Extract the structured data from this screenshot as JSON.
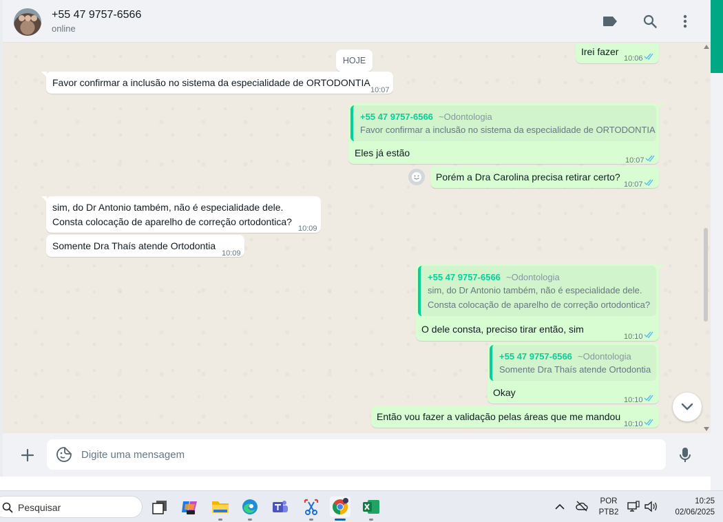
{
  "header": {
    "contact_name": "+55 47 9757-6566",
    "status": "online",
    "icons": [
      "label-icon",
      "search-icon",
      "menu-icon"
    ]
  },
  "chat": {
    "date_chip": "HOJE",
    "messages": [
      {
        "dir": "out",
        "text": "Irei fazer",
        "time": "10:06",
        "ticks": "read"
      },
      {
        "dir": "in",
        "text": "Favor confirmar a inclusão no sistema da especialidade de ORTODONTIA",
        "time": "10:07"
      },
      {
        "dir": "out",
        "quote": {
          "sender": "+55 47 9757-6566",
          "org": "~Odontologia",
          "lines": [
            "Favor confirmar a inclusão no sistema da especialidade de ORTODONTIA"
          ]
        },
        "text": "Eles já estão",
        "time": "10:07",
        "ticks": "read"
      },
      {
        "dir": "out",
        "text": "Porém a Dra Carolina precisa retirar certo?",
        "time": "10:07",
        "ticks": "read"
      },
      {
        "dir": "in",
        "lines": [
          "sim, do Dr Antonio também, não é especialidade dele.",
          "Consta colocação de aparelho de correção ortodontica?"
        ],
        "time": "10:09"
      },
      {
        "dir": "in",
        "text": "Somente Dra Thaís atende Ortodontia",
        "time": "10:09"
      },
      {
        "dir": "out",
        "quote": {
          "sender": "+55 47 9757-6566",
          "org": "~Odontologia",
          "lines": [
            "sim, do Dr Antonio também, não é especialidade dele.",
            "Consta colocação de aparelho de correção ortodontica?"
          ]
        },
        "text": "O dele consta, preciso tirar então, sim",
        "time": "10:10",
        "ticks": "read"
      },
      {
        "dir": "out",
        "quote": {
          "sender": "+55 47 9757-6566",
          "org": "~Odontologia",
          "lines": [
            "Somente Dra Thaís atende Ortodontia"
          ]
        },
        "text": "Okay",
        "time": "10:10",
        "ticks": "read"
      },
      {
        "dir": "out",
        "text": "Então vou fazer a validação pelas áreas que me mandou",
        "time": "10:10",
        "ticks": "read"
      }
    ]
  },
  "compose": {
    "placeholder": "Digite uma mensagem"
  },
  "taskbar": {
    "search_label": "Pesquisar",
    "apps": [
      "task-view",
      "copilot",
      "file-explorer",
      "edge",
      "teams",
      "snipping-tool",
      "chrome",
      "excel"
    ],
    "lang_line1": "POR",
    "lang_line2": "PTB2",
    "time": "10:25",
    "date": "02/06/2025"
  },
  "colors": {
    "accent": "#00a884",
    "outgoing_bubble": "#d9fdd3",
    "quote_sender": "#06cf9c",
    "read_ticks": "#53bdeb"
  }
}
